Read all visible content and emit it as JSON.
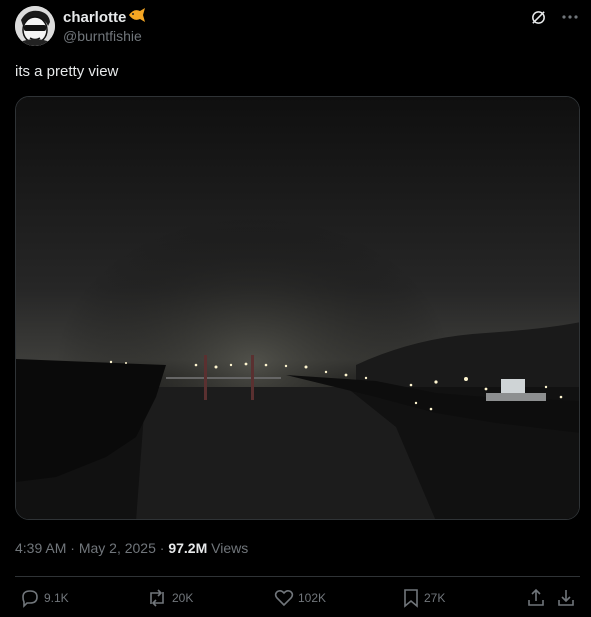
{
  "author": {
    "display_name": "charlotte",
    "handle": "@burntfishie",
    "avatar_icon": "avatar-cartoon-face",
    "badge_icon": "fish-emoji-icon"
  },
  "post": {
    "text": "its a pretty view",
    "media_description_icon": "night-river-photo"
  },
  "meta": {
    "time": "4:39 AM",
    "sep1": "·",
    "date": "May 2, 2025",
    "sep2": "·",
    "views_count": "97.2M",
    "views_label": "Views"
  },
  "actions": {
    "replies": "9.1K",
    "reposts": "20K",
    "likes": "102K",
    "bookmarks": "27K"
  },
  "colors": {
    "background": "#000000",
    "text": "#e7e9ea",
    "muted": "#71767b",
    "border": "#2f3336"
  }
}
